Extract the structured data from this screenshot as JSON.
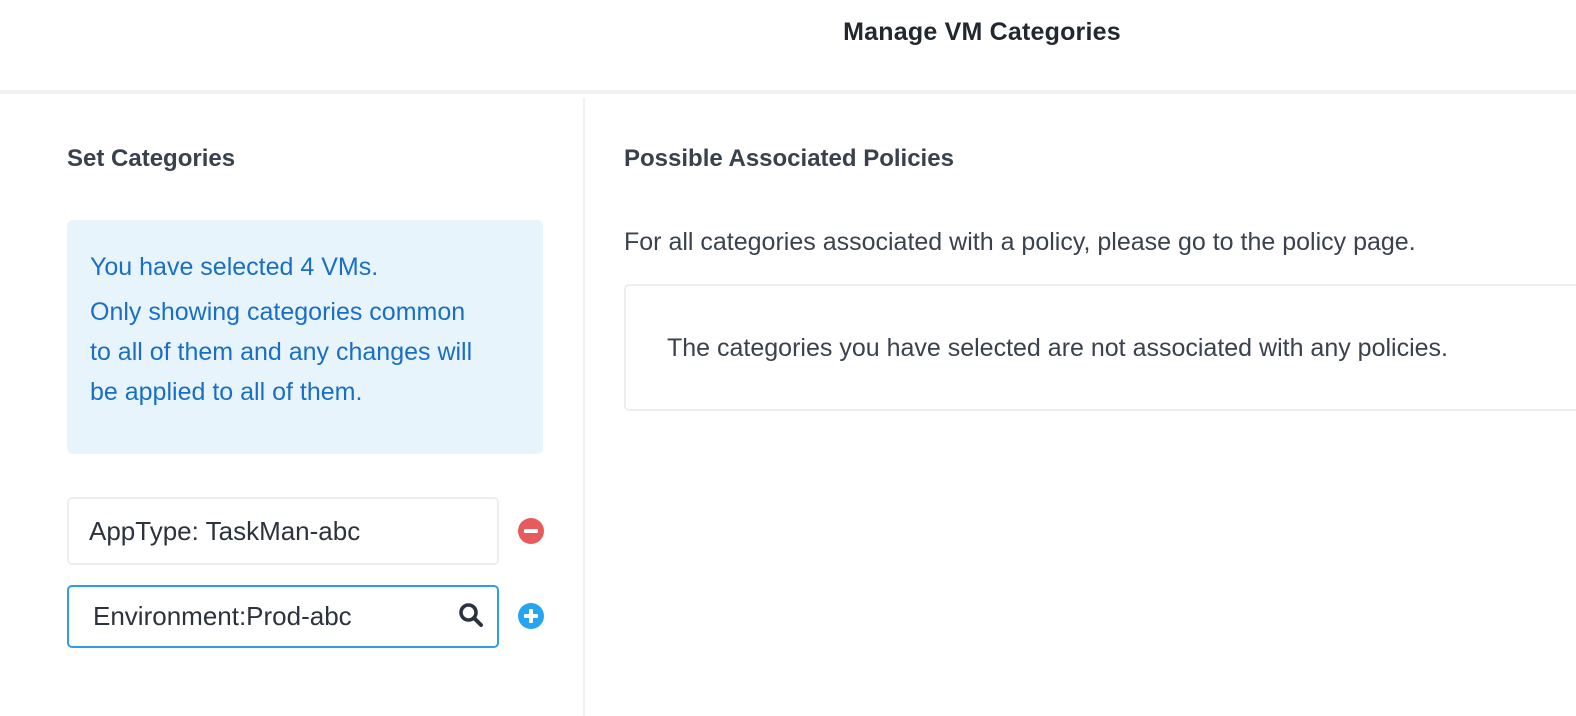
{
  "header": {
    "title": "Manage VM Categories"
  },
  "set_categories": {
    "title": "Set Categories",
    "info": {
      "selected_text": "You have selected 4 VMs.",
      "note_lines": [
        "Only showing categories common",
        "to all of them and any changes will",
        "be applied to all of them."
      ]
    },
    "categories": [
      {
        "value": "AppType: TaskMan-abc",
        "action_icon": "minus-circle-icon"
      }
    ],
    "search": {
      "value": "Environment:Prod-abc",
      "icon": "search-icon",
      "action_icon": "plus-circle-icon"
    }
  },
  "policies": {
    "title": "Possible Associated Policies",
    "description": "For all categories associated with a policy, please go to the policy page.",
    "empty_message": "The categories you have selected are not associated with any policies."
  },
  "colors": {
    "info_bg": "#e8f4fc",
    "info_text": "#1a6fc4",
    "remove": "#e65b5b",
    "add": "#27a4f0",
    "focus_border": "#2f9ce8"
  }
}
